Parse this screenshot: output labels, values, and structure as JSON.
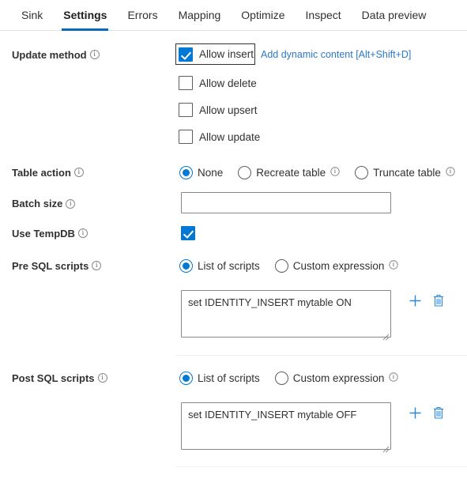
{
  "tabs": [
    {
      "label": "Sink",
      "active": false
    },
    {
      "label": "Settings",
      "active": true
    },
    {
      "label": "Errors",
      "active": false
    },
    {
      "label": "Mapping",
      "active": false
    },
    {
      "label": "Optimize",
      "active": false
    },
    {
      "label": "Inspect",
      "active": false
    },
    {
      "label": "Data preview",
      "active": false
    }
  ],
  "colors": {
    "accent": "#0078d4",
    "tab_active_underline": "#0b6ab8",
    "link": "#2b78c8",
    "icon_blue": "#2b88d8",
    "border": "#8a8886",
    "separator": "#efefef"
  },
  "update_method": {
    "label": "Update method",
    "dynamic_content_link": "Add dynamic content [Alt+Shift+D]",
    "options": [
      {
        "label": "Allow insert",
        "checked": true,
        "focused": true
      },
      {
        "label": "Allow delete",
        "checked": false,
        "focused": false
      },
      {
        "label": "Allow upsert",
        "checked": false,
        "focused": false
      },
      {
        "label": "Allow update",
        "checked": false,
        "focused": false
      }
    ]
  },
  "table_action": {
    "label": "Table action",
    "options": [
      {
        "label": "None",
        "selected": true,
        "info": false
      },
      {
        "label": "Recreate table",
        "selected": false,
        "info": true
      },
      {
        "label": "Truncate table",
        "selected": false,
        "info": true
      }
    ]
  },
  "batch_size": {
    "label": "Batch size",
    "value": "",
    "placeholder": ""
  },
  "use_tempdb": {
    "label": "Use TempDB",
    "checked": true
  },
  "pre_sql": {
    "label": "Pre SQL scripts",
    "mode_options": [
      {
        "label": "List of scripts",
        "selected": true,
        "info": false
      },
      {
        "label": "Custom expression",
        "selected": false,
        "info": true
      }
    ],
    "script": "set IDENTITY_INSERT mytable ON",
    "add_icon": "plus-icon",
    "delete_icon": "trash-icon"
  },
  "post_sql": {
    "label": "Post SQL scripts",
    "mode_options": [
      {
        "label": "List of scripts",
        "selected": true,
        "info": false
      },
      {
        "label": "Custom expression",
        "selected": false,
        "info": true
      }
    ],
    "script": "set IDENTITY_INSERT mytable OFF",
    "add_icon": "plus-icon",
    "delete_icon": "trash-icon"
  }
}
